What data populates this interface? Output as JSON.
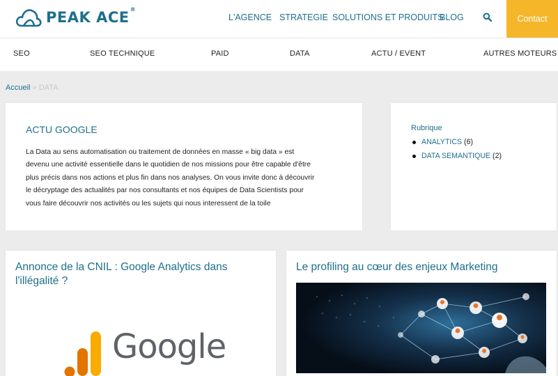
{
  "brand": {
    "name": "PEAK ACE",
    "registered": "®"
  },
  "mainnav": {
    "items": [
      "L'AGENCE",
      "STRATEGIE",
      "SOLUTIONS ET PRODUITS",
      "BLOG"
    ],
    "contact": "Contact"
  },
  "categories": [
    "SEO",
    "SEO TECHNIQUE",
    "PAID",
    "DATA",
    "ACTU / EVENT",
    "AUTRES MOTEURS"
  ],
  "breadcrumb": {
    "home": "Accueil",
    "separator": "»",
    "current": "DATA"
  },
  "intro": {
    "title": "ACTU GOOGLE",
    "lines": [
      "La Data au sens automatisation ou traitement de données en masse « big data » est",
      "devenu une activité essentielle dans le quotidien de nos missions pour être capable d'être",
      "plus précis dans nos actions et plus fin dans nos analyses. On vous invite donc à découvrir",
      "le décryptage des actualités par nos consultants et nos équipes de Data Scientists pour",
      "vous faire découvrir nos activités ou les sujets qui nous interessent de la toile"
    ]
  },
  "sidebar": {
    "title": "Rubrique",
    "items": [
      {
        "label": "ANALYTICS",
        "count": "(6)"
      },
      {
        "label": "DATA SEMANTIQUE",
        "count": "(2)"
      }
    ]
  },
  "cards": [
    {
      "title": "Annonce de la CNIL : Google Analytics dans l'illégalité ?",
      "image_text": "Google"
    },
    {
      "title": "Le profiling au cœur des enjeux Marketing"
    }
  ],
  "colors": {
    "accent": "#1e6f8c",
    "contact_bg": "#f6b62a",
    "background": "#ececec"
  },
  "icons": {
    "logo": "cloud-icon",
    "search": "search-icon"
  }
}
